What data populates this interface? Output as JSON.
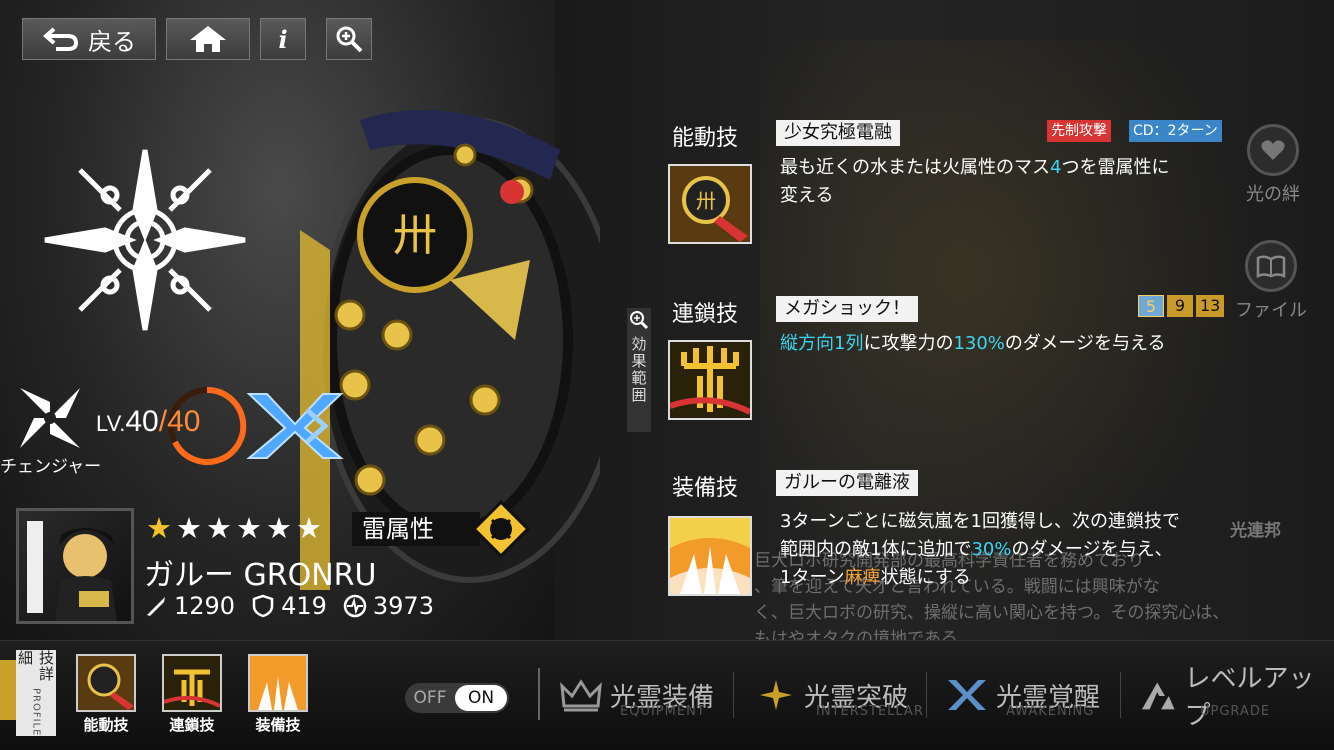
{
  "top_bar": {
    "back_label": "戻る",
    "home_icon": "home-icon",
    "info_label": "i",
    "zoom_icon": "magnifier-plus-icon"
  },
  "character": {
    "class_name": "チェンジャー",
    "level_label": "LV.",
    "level": "40",
    "level_max": "/40",
    "rarity_stars": 6,
    "stars": [
      "★",
      "★",
      "★",
      "★",
      "★",
      "★"
    ],
    "element": "雷属性",
    "name": "ガルー GRONRU",
    "attack": "1290",
    "defense": "419",
    "hp": "3973",
    "colors": {
      "gold": "#f2c230",
      "level_max": "#ff8a3a",
      "highlight": "#3fd4f0"
    }
  },
  "skills": {
    "active": {
      "type_label": "能動技",
      "name": "少女究極電融",
      "badge_first": "先制攻撃",
      "badge_cd": "CD：2ターン",
      "desc_line1_a": "最も近くの水または火属性のマス",
      "desc_line1_hl": "4",
      "desc_line1_b": "つを雷属性に",
      "desc_line2": "変える"
    },
    "chain": {
      "type_label": "連鎖技",
      "name": "メガショック！",
      "chain_counts": [
        "5",
        "9",
        "13"
      ],
      "desc_hl1": "縦方向1列",
      "desc_a": "に攻撃力の",
      "desc_hl2": "130%",
      "desc_b": "のダメージを与える"
    },
    "passive": {
      "type_label": "装備技",
      "name": "ガルーの電離液",
      "desc_line1": "3ターンごとに磁気嵐を1回獲得し、次の連鎖技で",
      "desc_line2_a": "範囲内の敵1体に追加で",
      "desc_line2_hl": "30%",
      "desc_line2_b": "のダメージを与え、",
      "desc_line3_a": "1ターン",
      "desc_line3_hl": "麻痺",
      "desc_line3_b": "状態にする"
    },
    "range_label": "効果範囲"
  },
  "side_buttons": {
    "bond_label": "光の絆",
    "file_label": "ファイル"
  },
  "profile": {
    "title": "光連邦",
    "text_line1": "巨大ロボ研究開発部の最高科学責任者を務めており",
    "text_line2": "、筆を迎えて天才と言われている。戦闘には興味がな",
    "text_line3": "く、巨大ロボの研究、操縦に高い関心を持つ。その探究心は、",
    "text_line4": "もはやオタクの境地である"
  },
  "bottom_bar": {
    "detail_tab": "技詳細",
    "detail_tab_en": "PROFILE",
    "mini_skills": [
      "能動技",
      "連鎖技",
      "装備技"
    ],
    "toggle_off": "OFF",
    "toggle_on": "ON",
    "nav": [
      {
        "label": "光霊装備",
        "sub": "EQUIPMENT"
      },
      {
        "label": "光霊突破",
        "sub": "INTERSTELLAR"
      },
      {
        "label": "光霊覚醒",
        "sub": "AWAKENING"
      },
      {
        "label": "レベルアップ",
        "sub": "UPGRADE"
      }
    ]
  }
}
